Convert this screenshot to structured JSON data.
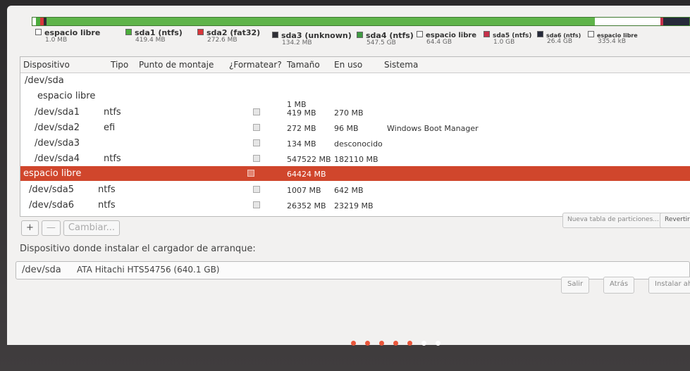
{
  "legend": [
    {
      "name": "espacio libre",
      "size": "1.0 MB",
      "color": "#ffffff"
    },
    {
      "name": "sda1 (ntfs)",
      "size": "419.4 MB",
      "color": "#4cad3c"
    },
    {
      "name": "sda2 (fat32)",
      "size": "272.6 MB",
      "color": "#d8363a"
    },
    {
      "name": "sda3 (unknown)",
      "size": "134.2 MB",
      "color": "#2f2f35"
    },
    {
      "name": "sda4 (ntfs)",
      "size": "547.5 GB",
      "color": "#3f9b42"
    },
    {
      "name": "espacio libre",
      "size": "64.4 GB",
      "color": "#ffffff"
    },
    {
      "name": "sda5 (ntfs)",
      "size": "1.0 GB",
      "color": "#c7314a"
    },
    {
      "name": "sda6 (ntfs)",
      "size": "26.4 GB",
      "color": "#262a3a"
    },
    {
      "name": "espacio libre",
      "size": "335.4 kB",
      "color": "#ffffff"
    }
  ],
  "columns": [
    "Dispositivo",
    "Tipo",
    "Punto de montaje",
    "¿Formatear?",
    "Tamaño",
    "En uso",
    "Sistema"
  ],
  "rows": [
    {
      "device": "/dev/sda",
      "type": "",
      "mount": "",
      "format": null,
      "size": "",
      "used": "",
      "system": ""
    },
    {
      "device": "espacio libre",
      "type": "",
      "mount": "",
      "format": null,
      "size": "1 MB",
      "used": "",
      "system": ""
    },
    {
      "device": "/dev/sda1",
      "type": "ntfs",
      "mount": "",
      "format": false,
      "size": "419 MB",
      "used": "270 MB",
      "system": ""
    },
    {
      "device": "/dev/sda2",
      "type": "efi",
      "mount": "",
      "format": false,
      "size": "272 MB",
      "used": "96 MB",
      "system": "Windows Boot Manager"
    },
    {
      "device": "/dev/sda3",
      "type": "",
      "mount": "",
      "format": false,
      "size": "134 MB",
      "used": "desconocido",
      "system": ""
    },
    {
      "device": "/dev/sda4",
      "type": "ntfs",
      "mount": "",
      "format": false,
      "size": "547522 MB",
      "used": "182110 MB",
      "system": ""
    },
    {
      "device": "espacio libre",
      "type": "",
      "mount": "",
      "format": false,
      "size": "64424 MB",
      "used": "",
      "system": "",
      "selected": true
    },
    {
      "device": "/dev/sda5",
      "type": "ntfs",
      "mount": "",
      "format": false,
      "size": "1007 MB",
      "used": "642 MB",
      "system": ""
    },
    {
      "device": "/dev/sda6",
      "type": "ntfs",
      "mount": "",
      "format": false,
      "size": "26352 MB",
      "used": "23219 MB",
      "system": ""
    }
  ],
  "toolbar": {
    "add": "+",
    "remove": "—",
    "change": "Cambiar..."
  },
  "partition_buttons": {
    "new_table": "Nueva tabla de particiones...",
    "revert": "Revertir"
  },
  "bootloader": {
    "label": "Dispositivo donde instalar el cargador de arranque:",
    "device": "/dev/sda",
    "description": "ATA Hitachi HTS54756 (640.1 GB)"
  },
  "nav": {
    "quit": "Salir",
    "back": "Atrás",
    "install": "Instalar aho"
  },
  "progress": {
    "steps": 7,
    "current": 5,
    "active_color": "#e9563a",
    "inactive_color": "#ffffff"
  }
}
